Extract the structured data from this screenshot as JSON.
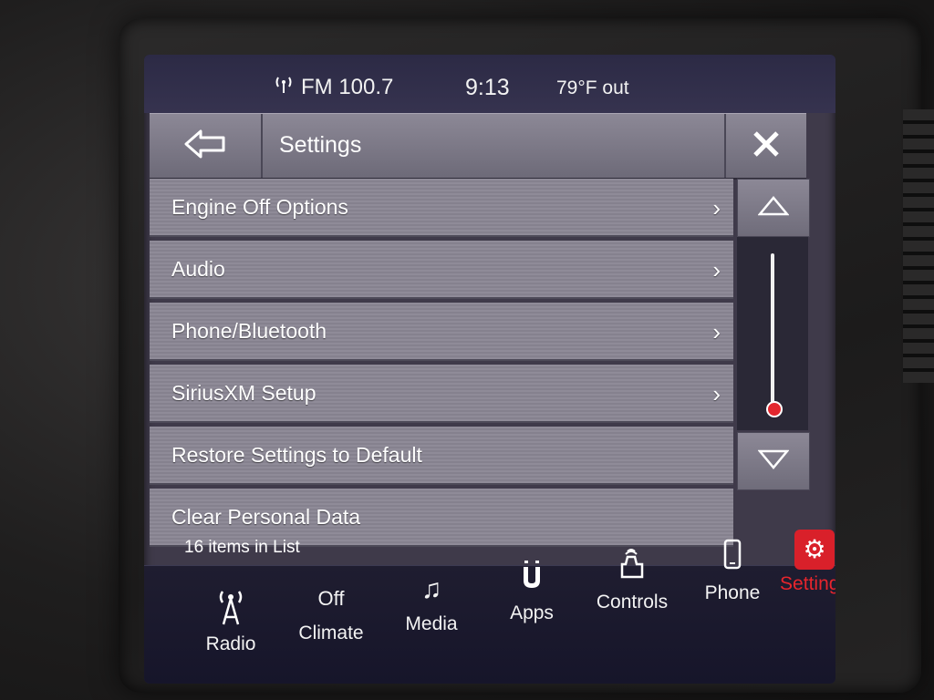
{
  "status": {
    "radio_label": "FM 100.7",
    "clock": "9:13",
    "outside_temp": "79°F out"
  },
  "header": {
    "title": "Settings"
  },
  "list": {
    "items": [
      {
        "label": "Engine Off Options",
        "has_chevron": true
      },
      {
        "label": "Audio",
        "has_chevron": true
      },
      {
        "label": "Phone/Bluetooth",
        "has_chevron": true
      },
      {
        "label": "SiriusXM Setup",
        "has_chevron": true
      },
      {
        "label": "Restore Settings to Default",
        "has_chevron": false
      },
      {
        "label": "Clear Personal Data",
        "has_chevron": false
      }
    ],
    "count_text": "16 items in List"
  },
  "nav": {
    "items": [
      {
        "label": "Radio",
        "icon": "radio-tower-icon",
        "active": false
      },
      {
        "label": "Climate",
        "icon": "climate-icon",
        "state": "Off",
        "active": false
      },
      {
        "label": "Media",
        "icon": "music-note-icon",
        "active": false
      },
      {
        "label": "Apps",
        "icon": "apps-icon",
        "active": false
      },
      {
        "label": "Controls",
        "icon": "controls-icon",
        "active": false
      },
      {
        "label": "Phone",
        "icon": "phone-icon",
        "active": false
      },
      {
        "label": "Settings",
        "icon": "gear-icon",
        "active": true
      }
    ]
  },
  "colors": {
    "accent": "#e8252c",
    "screen_bg": "#3f3a4a",
    "list_item": "#8f8b98"
  }
}
